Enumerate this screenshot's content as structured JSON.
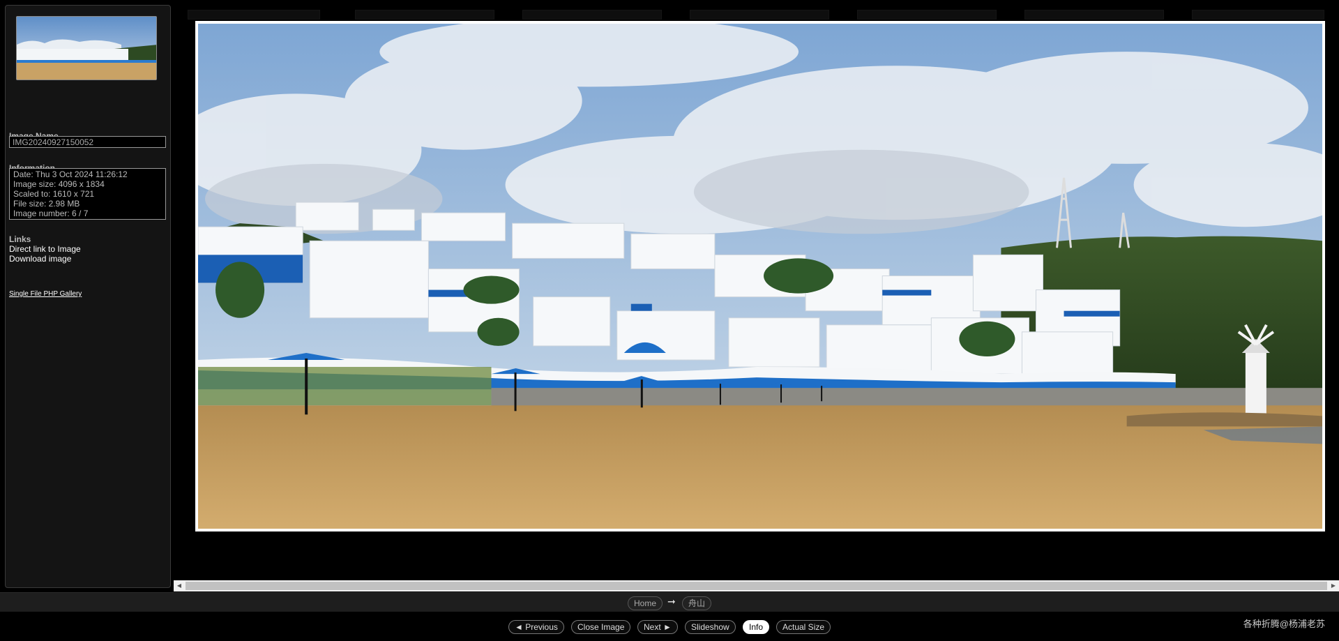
{
  "sidebar": {
    "image_name_label": "Image Name",
    "image_name_value": "IMG20240927150052",
    "information_label": "Information",
    "info_lines": [
      "Date: Thu 3 Oct 2024 11:26:12",
      "Image size: 4096 x 1834",
      "Scaled to: 1610 x 721",
      "File size: 2.98 MB",
      "Image number: 6 / 7"
    ],
    "links_label": "Links",
    "direct_link": "Direct link to Image",
    "download_link": "Download image",
    "credit": "Single File PHP Gallery"
  },
  "breadcrumb": {
    "home": "Home",
    "separator": "➞",
    "album": "舟山"
  },
  "nav": {
    "previous": "◄ Previous",
    "close": "Close Image",
    "next": "Next ►",
    "slideshow": "Slideshow",
    "info": "Info",
    "actual_size": "Actual Size"
  },
  "signature": "各种折腾@杨浦老苏",
  "colors": {
    "accent_blue": "#1e6fc8",
    "sky": "#8fb8e2",
    "sand": "#c9a265"
  }
}
